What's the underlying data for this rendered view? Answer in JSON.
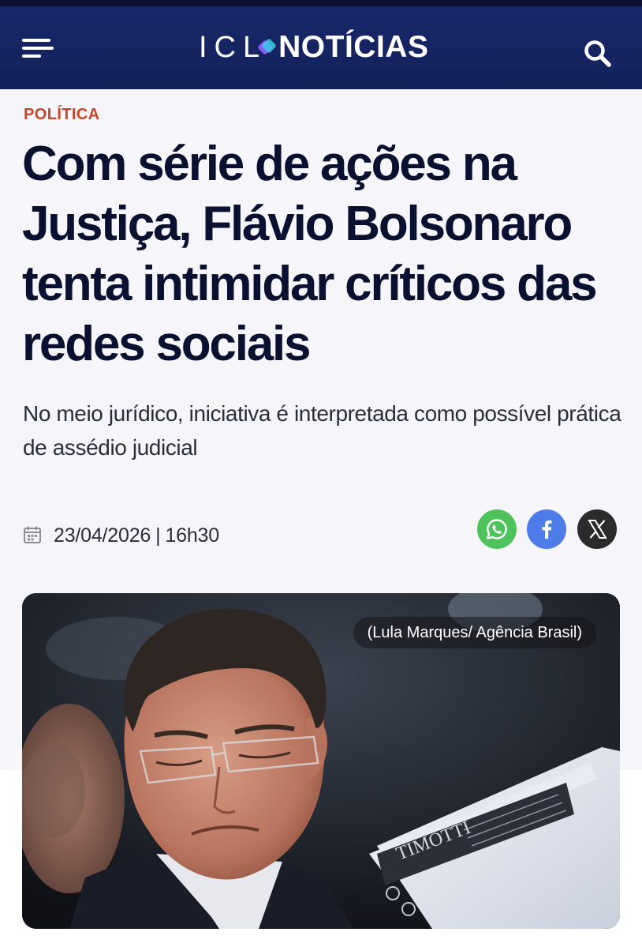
{
  "header": {
    "logo_left": "ICL",
    "logo_right": "NOTÍCIAS",
    "menu_icon": "hamburger-menu-icon",
    "search_icon": "search-icon",
    "background": "#17276a"
  },
  "article": {
    "category": "POLÍTICA",
    "title": "Com série de ações na Justiça, Flávio Bolsonaro tenta intimidar críticos das redes sociais",
    "subtitle": "No meio jurídico, iniciativa é interpretada como possível prática de assédio judicial",
    "date": "23/04/2026",
    "separator": "|",
    "time": "16h30",
    "category_color": "#c8452a",
    "title_color": "#0a1130"
  },
  "share": {
    "items": [
      {
        "network": "whatsapp",
        "icon": "whatsapp-icon",
        "color": "#4fc35b"
      },
      {
        "network": "facebook",
        "icon": "facebook-icon",
        "color": "#4d7ce8"
      },
      {
        "network": "x",
        "icon": "x-icon",
        "color": "#2b2b2b"
      }
    ]
  },
  "image": {
    "credit": "(Lula Marques/ Agência Brasil)",
    "document_label": "TIMOTTI"
  }
}
